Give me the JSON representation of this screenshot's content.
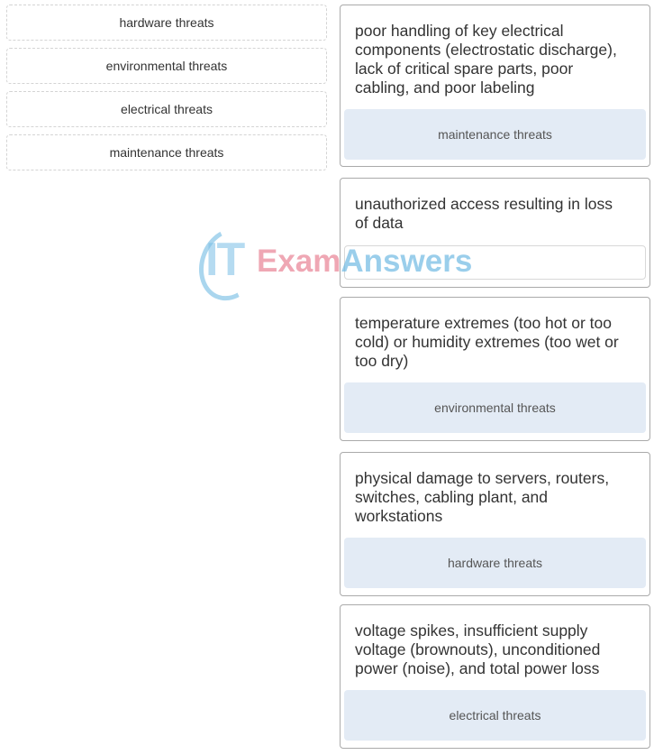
{
  "options": [
    {
      "label": "hardware threats"
    },
    {
      "label": "environmental threats"
    },
    {
      "label": "electrical threats"
    },
    {
      "label": "maintenance threats"
    }
  ],
  "targets": [
    {
      "description": "poor handling of key electrical components (electrostatic discharge), lack of critical spare parts, poor cabling, and poor labeling",
      "answer": "maintenance threats"
    },
    {
      "description": "unauthorized access resulting in loss of data",
      "answer": ""
    },
    {
      "description": "temperature extremes (too hot or too cold) or humidity extremes (too wet or too dry)",
      "answer": "environmental threats"
    },
    {
      "description": "physical damage to servers, routers, switches, cabling plant, and workstations",
      "answer": "hardware threats"
    },
    {
      "description": "voltage spikes, insufficient supply voltage (brownouts), unconditioned power (noise), and total power loss",
      "answer": "electrical threats"
    }
  ],
  "watermark": {
    "logo": "IT",
    "part1": "Exam",
    "part2": "Answers"
  },
  "colors": {
    "drop_zone_filled": "#e3ebf5",
    "card_border": "#aaaaaa",
    "option_border": "#d4d4d4"
  }
}
